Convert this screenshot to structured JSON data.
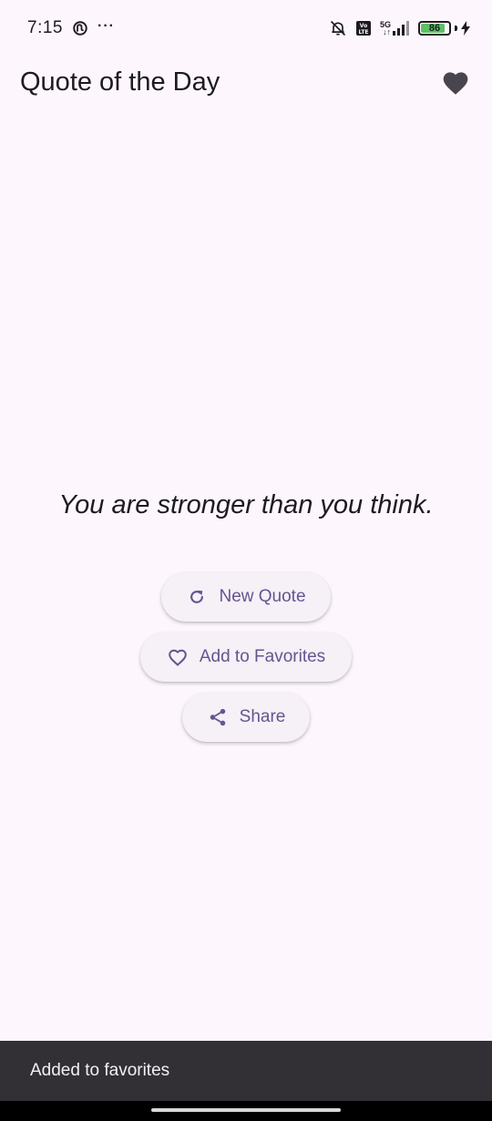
{
  "status_bar": {
    "time": "7:15",
    "overflow": "···",
    "network": "5G",
    "network_sub": "↓↑",
    "volte": "Vo LTE",
    "battery_level": 86,
    "battery_text": "86",
    "icons": [
      "sync-icon",
      "mute-icon",
      "volte-icon",
      "signal-icon",
      "battery-icon",
      "charging-icon"
    ]
  },
  "app_bar": {
    "title": "Quote of the Day",
    "favorite_icon": "heart-filled-icon"
  },
  "quote": {
    "text": "You are stronger than you think."
  },
  "actions": {
    "new_quote": {
      "label": "New Quote",
      "icon": "refresh-icon"
    },
    "add_favorite": {
      "label": "Add to Favorites",
      "icon": "heart-outline-icon"
    },
    "share": {
      "label": "Share",
      "icon": "share-icon"
    }
  },
  "snackbar": {
    "message": "Added to favorites"
  },
  "colors": {
    "background": "#fdf7fd",
    "button_bg": "#f6f0f7",
    "accent": "#65558f",
    "snackbar_bg": "#322f35",
    "snackbar_text": "#f4eff4",
    "battery_fill": "#5cc064"
  }
}
